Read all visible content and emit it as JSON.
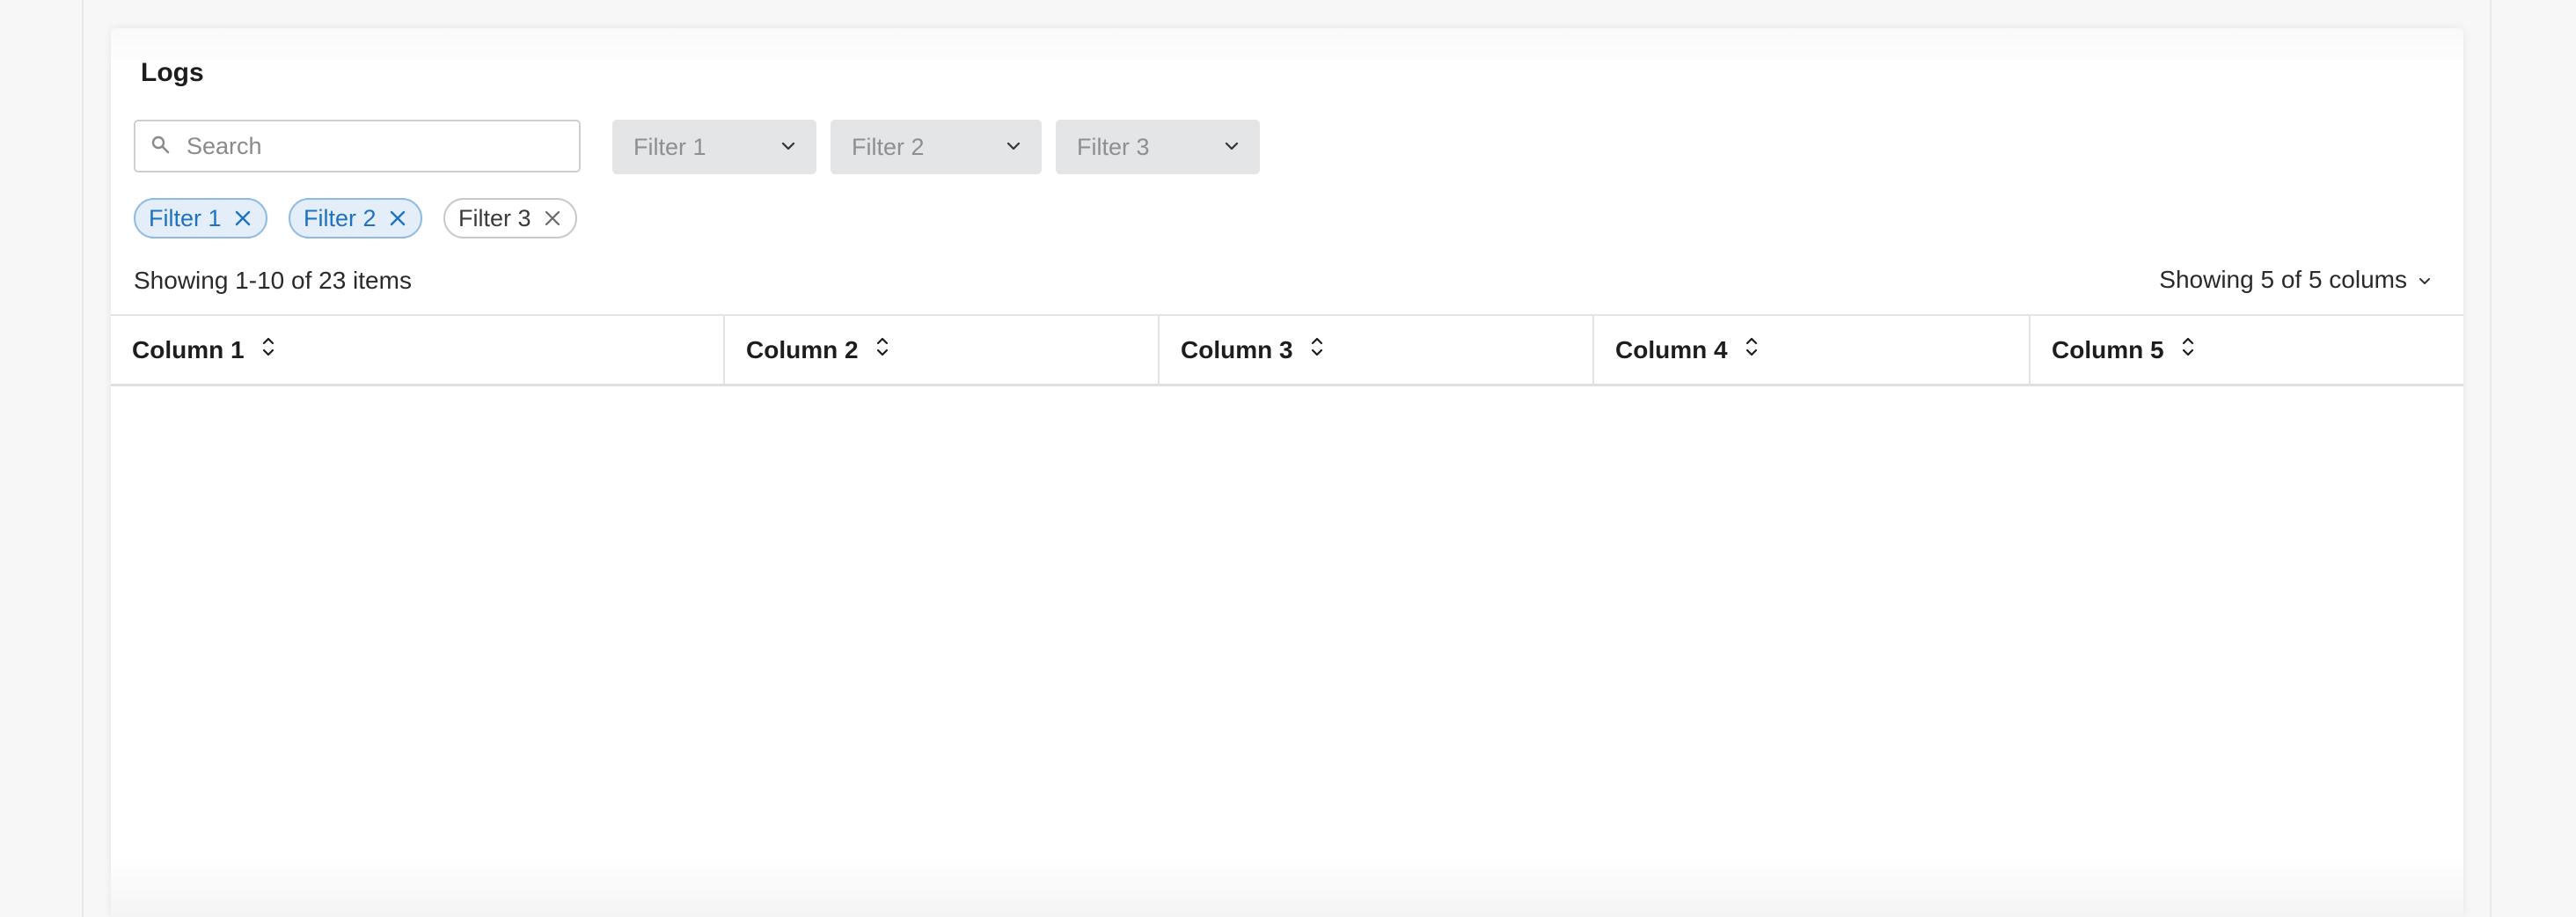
{
  "panel": {
    "title": "Logs"
  },
  "search": {
    "placeholder": "Search",
    "value": ""
  },
  "filters": {
    "dropdowns": [
      {
        "label": "Filter 1"
      },
      {
        "label": "Filter 2"
      },
      {
        "label": "Filter 3"
      }
    ],
    "chips": [
      {
        "label": "Filter 1",
        "active": true
      },
      {
        "label": "Filter 2",
        "active": true
      },
      {
        "label": "Filter 3",
        "active": false
      }
    ]
  },
  "summary": {
    "items_text": "Showing 1-10 of 23 items",
    "columns_text": "Showing 5 of 5 colums"
  },
  "table": {
    "columns": [
      {
        "label": "Column 1"
      },
      {
        "label": "Column 2"
      },
      {
        "label": "Column 3"
      },
      {
        "label": "Column 4"
      },
      {
        "label": "Column 5"
      }
    ],
    "rows": []
  },
  "colors": {
    "chip_active_bg": "#e3eef8",
    "chip_active_border": "#8fbbe0",
    "chip_active_text": "#1f72c2",
    "dropdown_bg": "#e4e5e7"
  },
  "icons": {
    "search": "search-icon",
    "dropdown": "chevron-down-icon",
    "chip_remove": "close-icon",
    "sort": "sort-icon"
  }
}
